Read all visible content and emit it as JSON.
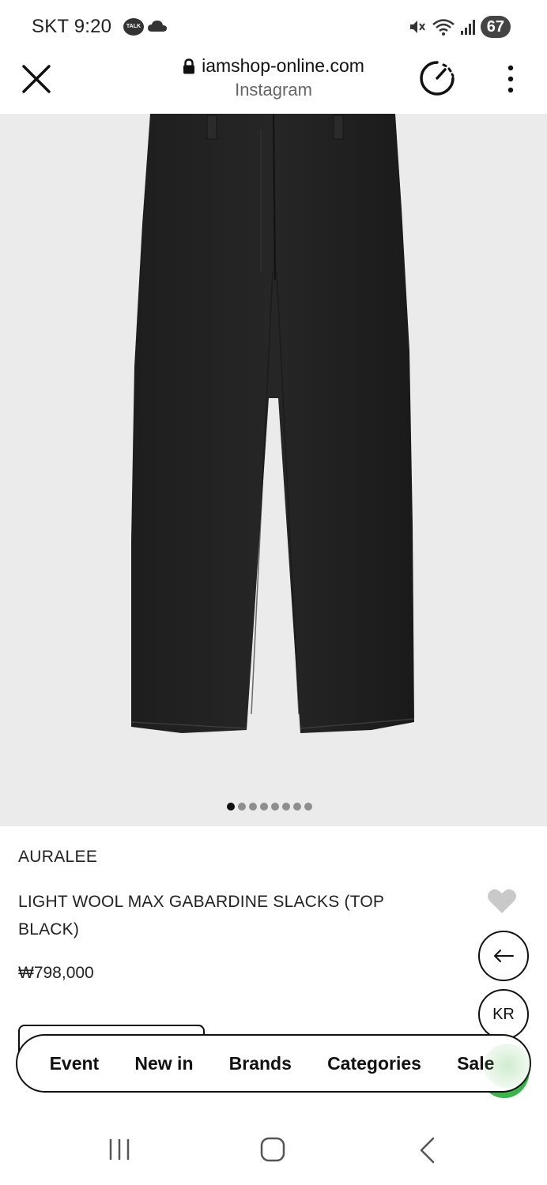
{
  "status_bar": {
    "carrier_time": "SKT 9:20",
    "talk_badge": "TALK",
    "battery": "67",
    "icons": [
      "talk-icon",
      "cloud-icon",
      "mute-icon",
      "wifi-icon",
      "signal-icon",
      "battery-icon"
    ]
  },
  "browser": {
    "url": "iamshop-online.com",
    "source": "Instagram",
    "icons": [
      "close-icon",
      "lock-icon",
      "speed-icon",
      "more-vertical-icon"
    ]
  },
  "gallery": {
    "image": "black wool slacks product photo",
    "dot_count": 8,
    "active_index": 0
  },
  "product": {
    "brand": "AURALEE",
    "name": "LIGHT WOOL MAX GABARDINE SLACKS (TOP BLACK)",
    "price": "₩798,000",
    "wishlist_icon": "heart-icon"
  },
  "floating_buttons": {
    "back_icon": "arrow-left-icon",
    "language": "KR"
  },
  "nav": {
    "items": [
      {
        "label": "Event"
      },
      {
        "label": "New in"
      },
      {
        "label": "Brands"
      },
      {
        "label": "Categories"
      },
      {
        "label": "Sale"
      }
    ]
  },
  "android_nav": {
    "icons": [
      "recents-icon",
      "home-icon",
      "back-icon"
    ]
  },
  "colors": {
    "image_bg": "#ebebeb",
    "accent_green": "#39b54a",
    "text": "#222222"
  }
}
